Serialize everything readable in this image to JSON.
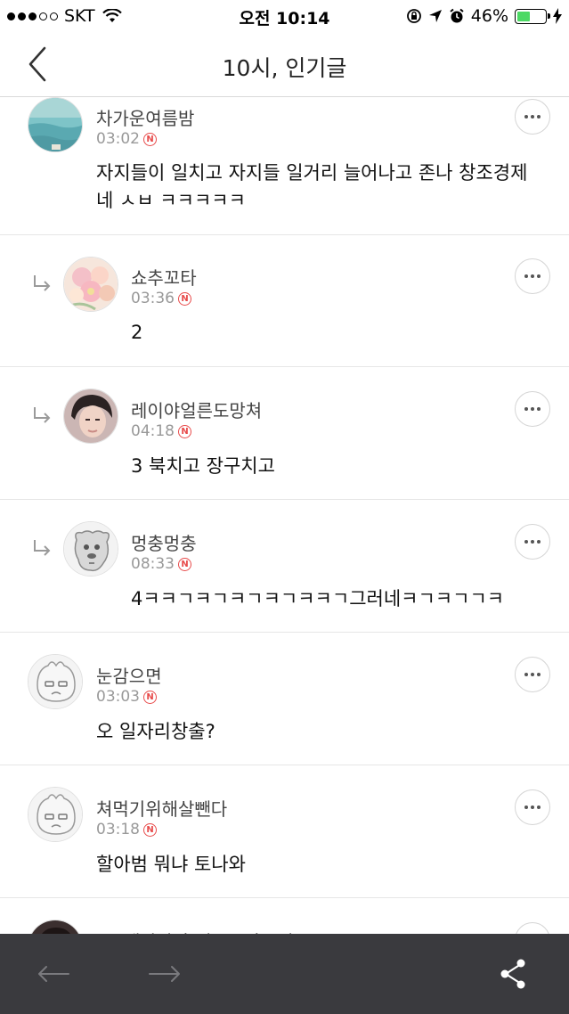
{
  "status_bar": {
    "carrier": "SKT",
    "time": "오전 10:14",
    "battery": "46%",
    "battery_level": 0.46,
    "battery_color": "#4cd964"
  },
  "header": {
    "title": "10시, 인기글",
    "back_icon": "chevron-left-icon"
  },
  "comments": [
    {
      "nickname": "차가운여름밤",
      "time": "03:02",
      "text": "자지들이 일치고 자지들 일거리 늘어나고 존나 창조경제네 ㅅㅂ ㅋㅋㅋㅋㅋ",
      "is_reply": false,
      "avatar": "ocean-photo"
    },
    {
      "nickname": "쇼추꼬타",
      "time": "03:36",
      "text": "2",
      "is_reply": true,
      "avatar": "flower-photo"
    },
    {
      "nickname": "레이야얼른도망쳐",
      "time": "04:18",
      "text": "3 북치고 장구치고",
      "is_reply": true,
      "avatar": "person-photo"
    },
    {
      "nickname": "멍충멍충",
      "time": "08:33",
      "text": "4ㅋㅋㄱㅋㄱㅋㄱㅋㄱㅋㅋㄱ그러네ㅋㄱㅋㄱㄱㅋ",
      "is_reply": true,
      "avatar": "dog-cartoon"
    },
    {
      "nickname": "눈감으면",
      "time": "03:03",
      "text": "오 일자리창출?",
      "is_reply": false,
      "avatar": "apeach-cartoon"
    },
    {
      "nickname": "쳐먹기위해살뺀다",
      "time": "03:18",
      "text": "할아범 뭐냐 토나와",
      "is_reply": false,
      "avatar": "apeach-cartoon"
    },
    {
      "nickname": "· 무생각남자 정국콩자구연 ·",
      "time": "",
      "text": "",
      "is_reply": false,
      "avatar": "person-photo"
    }
  ],
  "new_badge": "N",
  "bottom_bar": {
    "back_icon": "arrow-left-icon",
    "forward_icon": "arrow-right-icon",
    "share_icon": "share-icon"
  }
}
